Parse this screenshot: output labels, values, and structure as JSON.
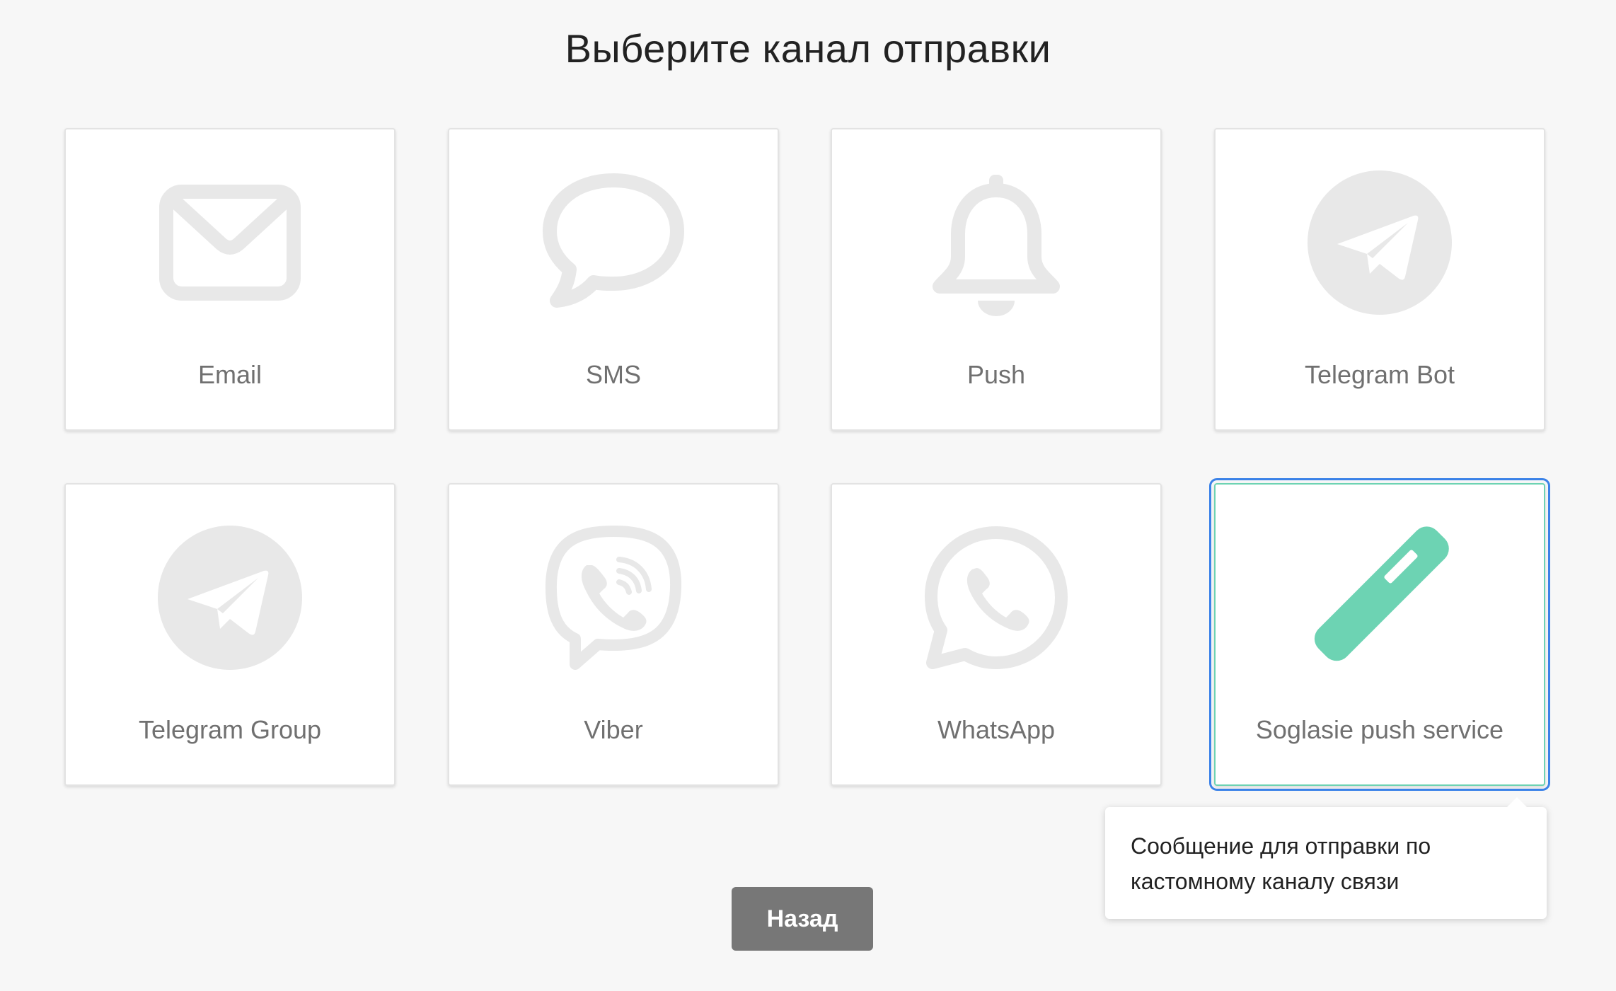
{
  "page": {
    "title": "Выберите канал отправки"
  },
  "channels": [
    {
      "label": "Email",
      "icon": "envelope-icon"
    },
    {
      "label": "SMS",
      "icon": "speech-bubble-icon"
    },
    {
      "label": "Push",
      "icon": "bell-icon"
    },
    {
      "label": "Telegram Bot",
      "icon": "telegram-icon"
    },
    {
      "label": "Telegram Group",
      "icon": "telegram-icon"
    },
    {
      "label": "Viber",
      "icon": "viber-icon"
    },
    {
      "label": "WhatsApp",
      "icon": "whatsapp-icon"
    },
    {
      "label": "Soglasie push service",
      "icon": "custom-channel-icon",
      "selected": true
    }
  ],
  "tooltip": {
    "text": "Сообщение для отправки по кастомному каналу связи"
  },
  "actions": {
    "back_label": "Назад"
  },
  "colors": {
    "background": "#f7f7f7",
    "icon_inactive": "#e8e8e8",
    "icon_active": "#6dd3b3",
    "selection_outline": "#3b82e8",
    "button": "#777777"
  }
}
